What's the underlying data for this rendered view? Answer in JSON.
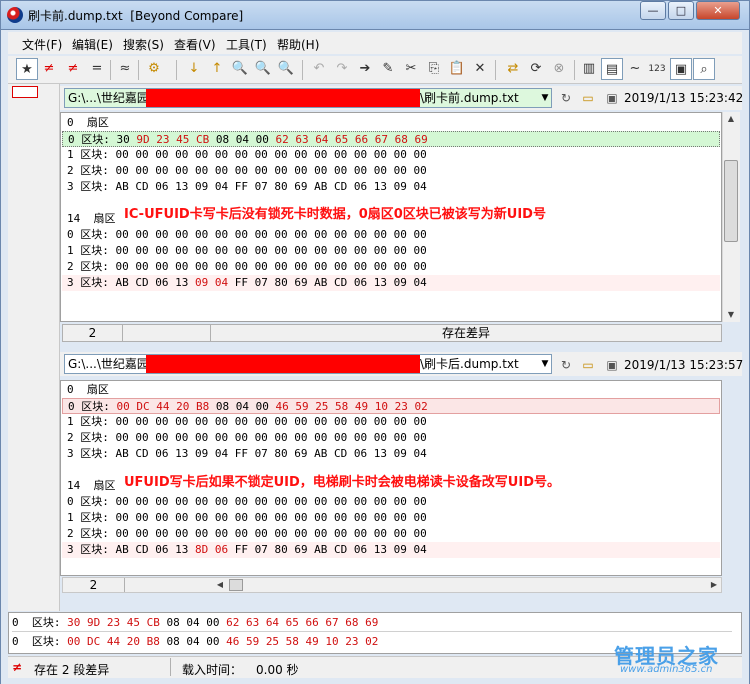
{
  "window": {
    "title": "刷卡前.dump.txt  [Beyond Compare]",
    "buttons": {
      "minimize": "—",
      "maximize": "□",
      "close": "✕"
    }
  },
  "menu": [
    "文件(F)",
    "编辑(E)",
    "搜索(S)",
    "查看(V)",
    "工具(T)",
    "帮助(H)"
  ],
  "toolbar": {
    "all": "★",
    "diffs": "≠",
    "same_diffs": "≠",
    "same": "=",
    "context": "≈",
    "rules": "⚙",
    "prev_diff": "↓",
    "next_diff": "↑",
    "find": "🔍",
    "undo": "↶",
    "redo": "↷",
    "copy_to": "➔",
    "edit": "✎",
    "cut": "✂",
    "copy": "⎘",
    "paste": "📋",
    "delete": "✕",
    "swap": "⇄",
    "refresh": "⟳",
    "stop": "⊗",
    "layout1": "▥",
    "layout2": "▤",
    "ignore": "~",
    "numbers": "123",
    "icons": "▣",
    "zoom": "⌕"
  },
  "top": {
    "path_prefix": "G:\\...\\世纪嘉园",
    "path_suffix": "\\刷卡前.dump.txt",
    "timestamp": "2019/1/13  15:23:42",
    "lines": [
      {
        "tokens": [
          [
            "0  扇区",
            0
          ]
        ],
        "style": ""
      },
      {
        "tokens": [
          [
            "0 区块: 30 ",
            0
          ],
          [
            "9D 23 45 CB",
            1
          ],
          [
            " 08 04 00 ",
            0
          ],
          [
            "62 63 64 65 66 67 68 69",
            1
          ]
        ],
        "style": "sel"
      },
      {
        "tokens": [
          [
            "1 区块: 00 00 00 00 00 00 00 00 00 00 00 00 00 00 00 00",
            0
          ]
        ],
        "style": ""
      },
      {
        "tokens": [
          [
            "2 区块: 00 00 00 00 00 00 00 00 00 00 00 00 00 00 00 00",
            0
          ]
        ],
        "style": ""
      },
      {
        "tokens": [
          [
            "3 区块: AB CD 06 13 09 04 FF 07 80 69 AB CD 06 13 09 04",
            0
          ]
        ],
        "style": ""
      },
      {
        "tokens": [
          [
            "",
            0
          ]
        ],
        "style": ""
      },
      {
        "tokens": [
          [
            "14  扇区",
            0
          ]
        ],
        "style": ""
      },
      {
        "tokens": [
          [
            "0 区块: 00 00 00 00 00 00 00 00 00 00 00 00 00 00 00 00",
            0
          ]
        ],
        "style": ""
      },
      {
        "tokens": [
          [
            "1 区块: 00 00 00 00 00 00 00 00 00 00 00 00 00 00 00 00",
            0
          ]
        ],
        "style": ""
      },
      {
        "tokens": [
          [
            "2 区块: 00 00 00 00 00 00 00 00 00 00 00 00 00 00 00 00",
            0
          ]
        ],
        "style": ""
      },
      {
        "tokens": [
          [
            "3 区块: AB CD 06 13 ",
            0
          ],
          [
            "09 04",
            1
          ],
          [
            " FF 07 80 69 AB CD 06 13 09 04",
            0
          ]
        ],
        "style": "pink"
      }
    ],
    "note": "IC-UFUID卡写卡后没有锁死卡时数据，0扇区0区块已被该写为新UID号",
    "status_line": "2",
    "status_text": "存在差异"
  },
  "bottom": {
    "path_prefix": "G:\\...\\世纪嘉园",
    "path_suffix": "\\刷卡后.dump.txt",
    "timestamp": "2019/1/13  15:23:57",
    "lines": [
      {
        "tokens": [
          [
            "0  扇区",
            0
          ]
        ],
        "style": ""
      },
      {
        "tokens": [
          [
            "0 区块: ",
            0
          ],
          [
            "00 DC 44 20 B8",
            1
          ],
          [
            " 08 04 00 ",
            0
          ],
          [
            "46 59 25 58 49 10 23 02",
            1
          ]
        ],
        "style": "sel2"
      },
      {
        "tokens": [
          [
            "1 区块: 00 00 00 00 00 00 00 00 00 00 00 00 00 00 00 00",
            0
          ]
        ],
        "style": ""
      },
      {
        "tokens": [
          [
            "2 区块: 00 00 00 00 00 00 00 00 00 00 00 00 00 00 00 00",
            0
          ]
        ],
        "style": ""
      },
      {
        "tokens": [
          [
            "3 区块: AB CD 06 13 09 04 FF 07 80 69 AB CD 06 13 09 04",
            0
          ]
        ],
        "style": ""
      },
      {
        "tokens": [
          [
            "",
            0
          ]
        ],
        "style": ""
      },
      {
        "tokens": [
          [
            "14  扇区",
            0
          ]
        ],
        "style": ""
      },
      {
        "tokens": [
          [
            "0 区块: 00 00 00 00 00 00 00 00 00 00 00 00 00 00 00 00",
            0
          ]
        ],
        "style": ""
      },
      {
        "tokens": [
          [
            "1 区块: 00 00 00 00 00 00 00 00 00 00 00 00 00 00 00 00",
            0
          ]
        ],
        "style": ""
      },
      {
        "tokens": [
          [
            "2 区块: 00 00 00 00 00 00 00 00 00 00 00 00 00 00 00 00",
            0
          ]
        ],
        "style": ""
      },
      {
        "tokens": [
          [
            "3 区块: AB CD 06 13 ",
            0
          ],
          [
            "8D 06",
            1
          ],
          [
            " FF 07 80 69 AB CD 06 13 09 04",
            0
          ]
        ],
        "style": "pink"
      }
    ],
    "note": "UFUID写卡后如果不锁定UID，电梯刷卡时会被电梯读卡设备改写UID号。",
    "status_line": "2"
  },
  "compare_lines": [
    {
      "tokens": [
        [
          "0  区块: ",
          0
        ],
        [
          "30 9D 23 45 CB",
          1
        ],
        [
          " 08 04 00 ",
          0
        ],
        [
          "62 63 64 65 66 67 68 69",
          1
        ]
      ]
    },
    {
      "tokens": [
        [
          "0  区块: ",
          0
        ],
        [
          "00 DC 44 20 B8",
          1
        ],
        [
          " 08 04 00 ",
          0
        ],
        [
          "46 59 25 58 49 10 23 02",
          1
        ]
      ]
    }
  ],
  "status": {
    "diff_icon": "≠",
    "diff_count": "存在 2 段差异",
    "load_label": "载入时间：",
    "load_time": "0.00 秒"
  },
  "watermark": {
    "text": "管理员之家",
    "url": "www.admin365.cn"
  }
}
